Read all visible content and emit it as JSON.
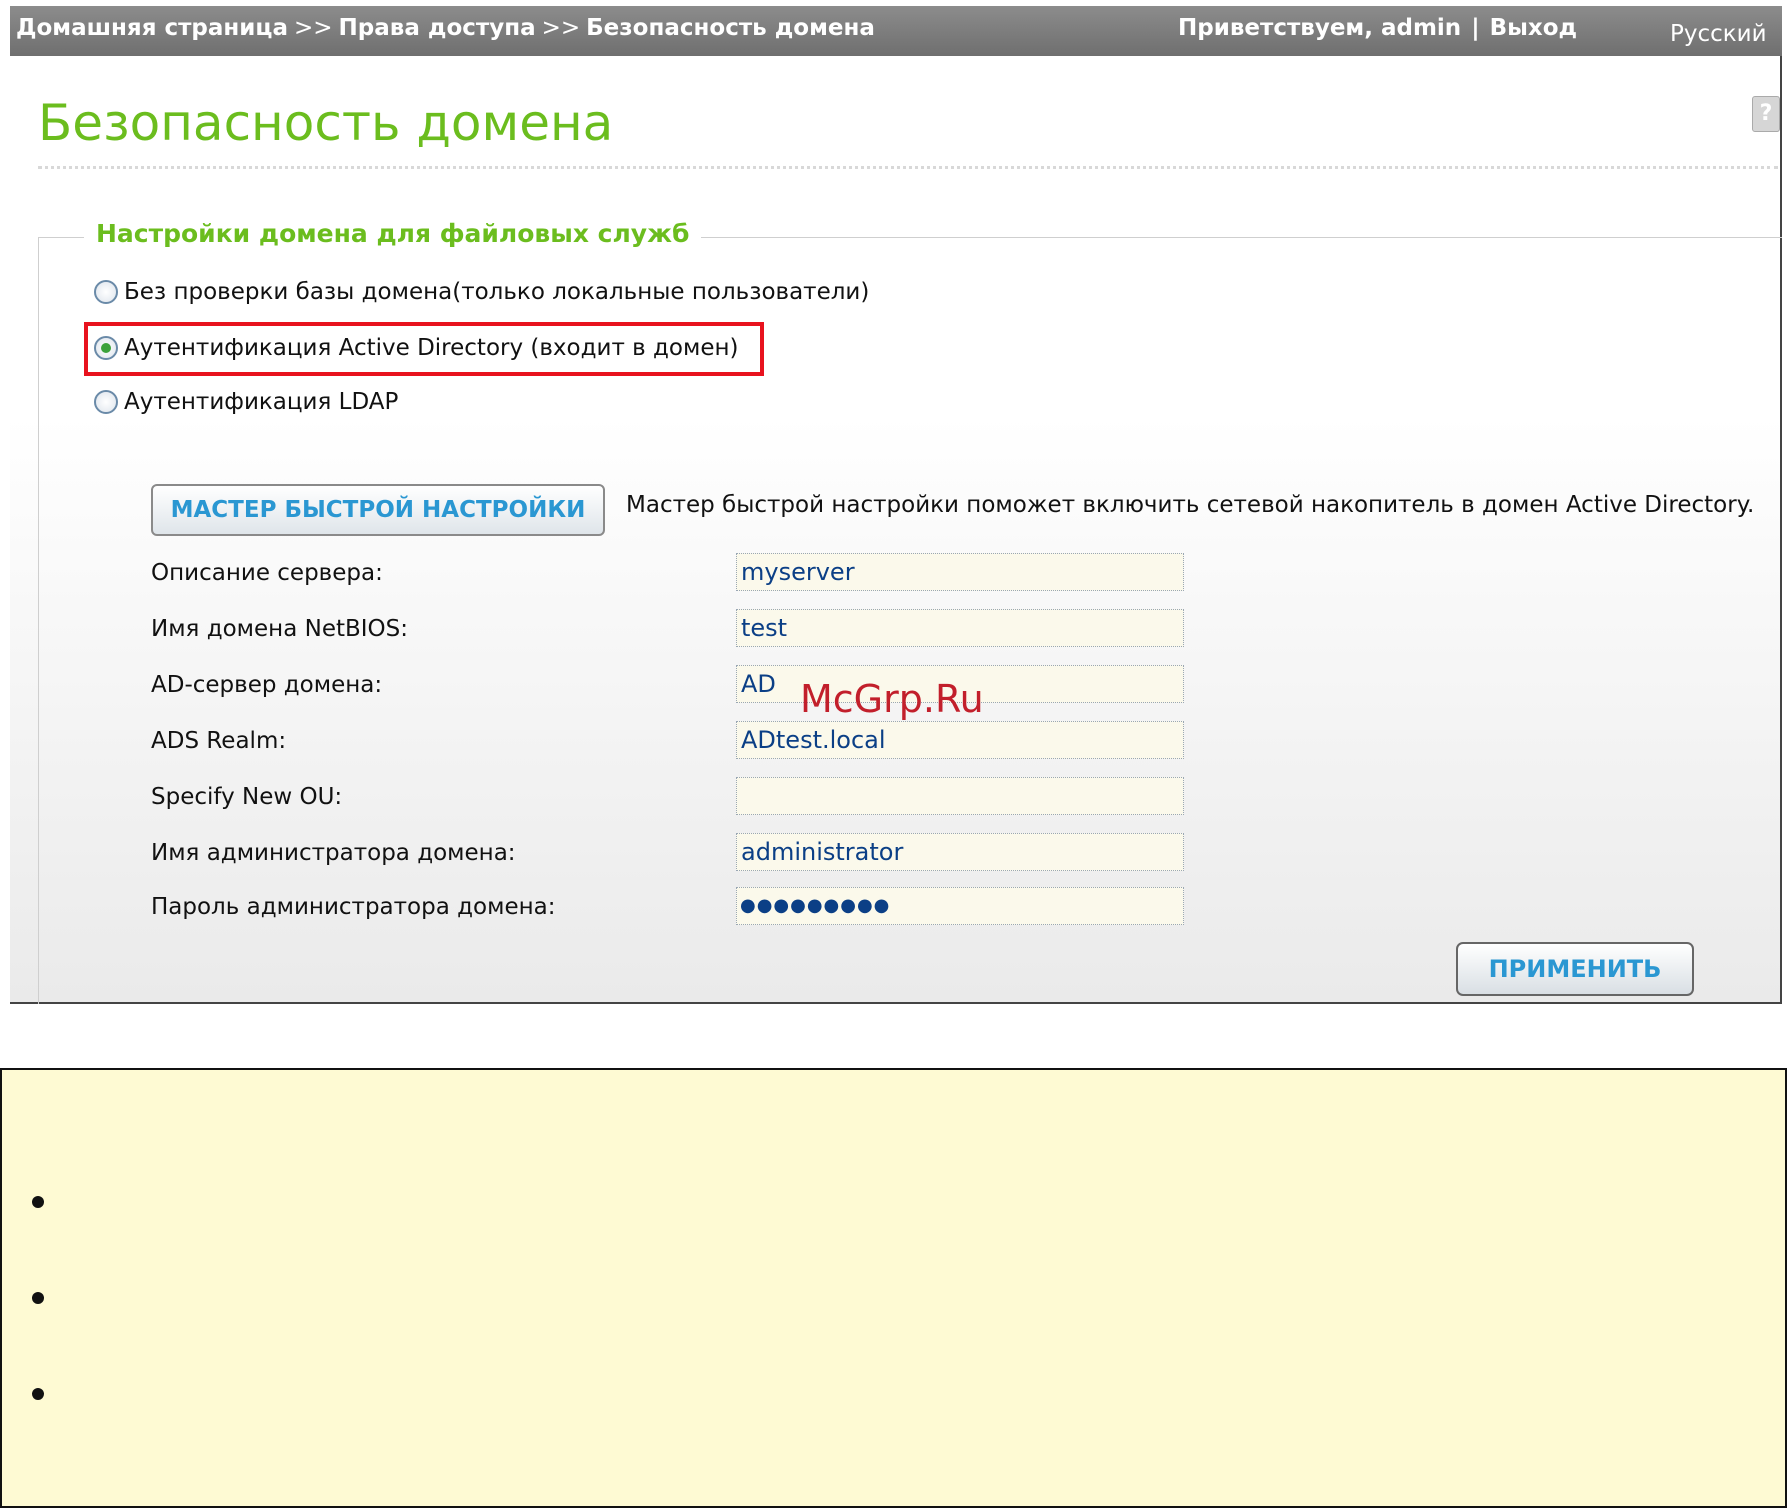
{
  "topbar": {
    "crumbs": [
      "Домашняя страница",
      "Права доступа",
      "Безопасность домена"
    ],
    "separator": ">>",
    "greeting": "Приветствуем, admin",
    "divider": "|",
    "logout": "Выход",
    "language": "Русский"
  },
  "page": {
    "title": "Безопасность домена",
    "help_icon": "help-icon"
  },
  "section": {
    "title": "Настройки домена для файловых служб",
    "options": [
      {
        "label": "Без проверки базы домена(только локальные пользователи)",
        "checked": false
      },
      {
        "label": "Аутентификация Active Directory (входит в домен)",
        "checked": true
      },
      {
        "label": "Аутентификация LDAP",
        "checked": false
      }
    ]
  },
  "wizard": {
    "button": "МАСТЕР БЫСТРОЙ НАСТРОЙКИ",
    "description": "Мастер быстрой настройки поможет включить сетевой накопитель в домен Active Directory."
  },
  "form": {
    "fields": [
      {
        "label": "Описание сервера:",
        "value": "myserver"
      },
      {
        "label": "Имя домена NetBIOS:",
        "value": "test"
      },
      {
        "label": "AD-сервер домена:",
        "value": "AD"
      },
      {
        "label": "ADS Realm:",
        "value": "ADtest.local"
      },
      {
        "label": "Specify New OU:",
        "value": ""
      },
      {
        "label": "Имя администратора домена:",
        "value": "administrator"
      },
      {
        "label": "Пароль администратора домена:",
        "value": "●●●●●●●●●"
      }
    ],
    "apply": "ПРИМЕНИТЬ"
  },
  "watermark": "McGrp.Ru",
  "colors": {
    "title_green": "#6bbd1e",
    "button_text": "#2a97d2",
    "highlight_red": "#e8121e",
    "note_bg": "#fefad3"
  }
}
